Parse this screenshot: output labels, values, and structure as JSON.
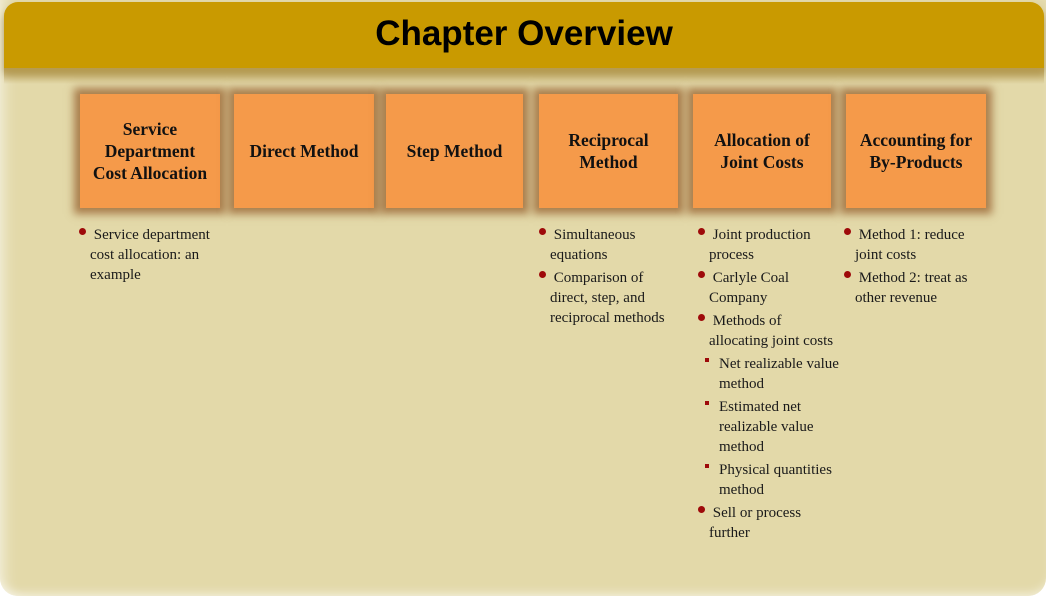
{
  "slide": {
    "title": "Chapter Overview"
  },
  "colors": {
    "title_bar": "#c99a00",
    "background": "#e3d9a9",
    "box": "#f59a4a",
    "bullet": "#9e0a0a"
  },
  "columns": [
    {
      "header": "Service\nDepartment\nCost Allocation",
      "items": [
        {
          "text": "Service department cost allocation: an example",
          "sub": []
        }
      ]
    },
    {
      "header": "Direct Method",
      "items": []
    },
    {
      "header": "Step Method",
      "items": []
    },
    {
      "header": "Reciprocal\nMethod",
      "items": [
        {
          "text": "Simultaneous equations",
          "sub": []
        },
        {
          "text": "Comparison of direct, step, and reciprocal methods",
          "sub": []
        }
      ]
    },
    {
      "header": "Allocation of\nJoint Costs",
      "items": [
        {
          "text": "Joint production process",
          "sub": []
        },
        {
          "text": "Carlyle Coal Company",
          "sub": []
        },
        {
          "text": "Methods of allocating joint costs",
          "sub": [
            "Net realizable value method",
            "Estimated net realizable value method",
            "Physical quantities method"
          ]
        },
        {
          "text": "Sell or process further",
          "sub": []
        }
      ]
    },
    {
      "header": "Accounting for\nBy-Products",
      "items": [
        {
          "text": "Method 1: reduce joint costs",
          "sub": []
        },
        {
          "text": "Method 2: treat as other revenue",
          "sub": []
        }
      ]
    }
  ]
}
